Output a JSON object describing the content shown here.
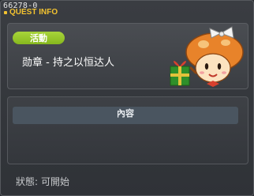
{
  "window": {
    "quest_id": "66278-0",
    "title": "QUEST INFO"
  },
  "quest": {
    "category": "活動",
    "name": "勋章 - 持之以恒达人"
  },
  "content": {
    "header": "內容"
  },
  "status": {
    "label": "狀態:",
    "value": "可開始"
  },
  "colors": {
    "title_accent": "#f2c230",
    "category_badge": "#9bc92f"
  }
}
